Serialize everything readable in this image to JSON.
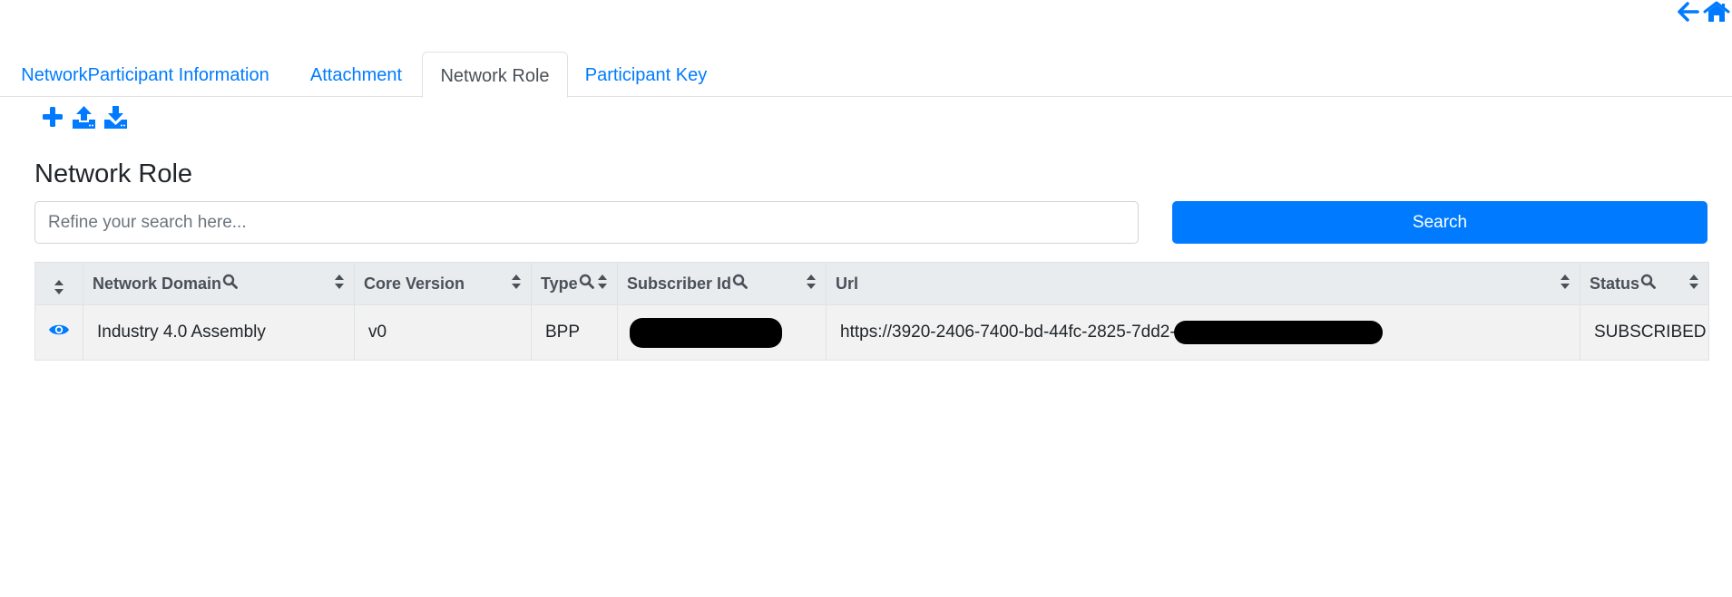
{
  "nav": {
    "back_icon": "arrow-left-icon",
    "home_icon": "home-icon"
  },
  "tabs": [
    {
      "label": "NetworkParticipant Information",
      "active": false
    },
    {
      "label": "Attachment",
      "active": false
    },
    {
      "label": "Network Role",
      "active": true
    },
    {
      "label": "Participant Key",
      "active": false
    }
  ],
  "toolbar": {
    "icons": [
      "plus-icon",
      "upload-icon",
      "download-icon"
    ]
  },
  "page": {
    "title": "Network Role"
  },
  "search": {
    "placeholder": "Refine your search here...",
    "value": "",
    "button_label": "Search"
  },
  "table": {
    "columns": [
      {
        "label": "",
        "sortable": true,
        "searchable": false
      },
      {
        "label": "Network Domain",
        "sortable": true,
        "searchable": true
      },
      {
        "label": "Core Version",
        "sortable": true,
        "searchable": false
      },
      {
        "label": "Type",
        "sortable": true,
        "searchable": true
      },
      {
        "label": "Subscriber Id",
        "sortable": true,
        "searchable": true
      },
      {
        "label": "Url",
        "sortable": true,
        "searchable": false
      },
      {
        "label": "Status",
        "sortable": true,
        "searchable": true
      }
    ],
    "rows": [
      {
        "action_icon": "eye-icon",
        "network_domain": "Industry 4.0 Assembly",
        "core_version": "v0",
        "type": "BPP",
        "subscriber_id": "",
        "url": "https://3920-2406-7400-bd-44fc-2825-7dd2-",
        "status": "SUBSCRIBED"
      }
    ]
  },
  "colors": {
    "accent": "#007bff",
    "header_bg": "#e9ecef",
    "row_bg": "#f2f2f2",
    "border": "#dee2e6"
  }
}
